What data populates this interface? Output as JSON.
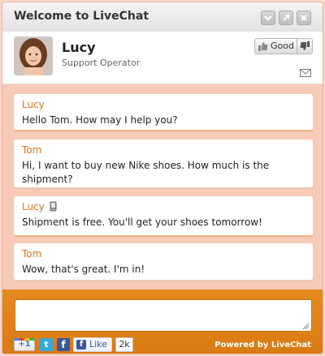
{
  "window": {
    "title": "Welcome to LiveChat"
  },
  "operator": {
    "name": "Lucy",
    "role": "Support Operator",
    "rate_good_label": "Good"
  },
  "messages": [
    {
      "sender": "Lucy",
      "text": "Hello Tom. How may I help you?"
    },
    {
      "sender": "Tom",
      "text": "Hi, I want to buy new Nike shoes. How much is the shipment?"
    },
    {
      "sender": "Lucy",
      "text": "Shipment is free. You'll get your shoes tomorrow!"
    },
    {
      "sender": "Tom",
      "text": "Wow, that's great. I'm in!"
    }
  ],
  "footer": {
    "gplus_label": "+1",
    "twitter_label": "t",
    "facebook_label": "f",
    "like_label": "Like",
    "like_count": "2k",
    "powered_by": "Powered by LiveChat"
  },
  "colors": {
    "accent": "#d97a12",
    "sender": "#d8731c",
    "frame": "#f7c9b7"
  },
  "icons": [
    "minimize-icon",
    "popout-icon",
    "close-icon",
    "thumbs-up-icon",
    "thumbs-down-icon",
    "envelope-icon",
    "mobile-phone-icon",
    "resize-handle-icon"
  ]
}
